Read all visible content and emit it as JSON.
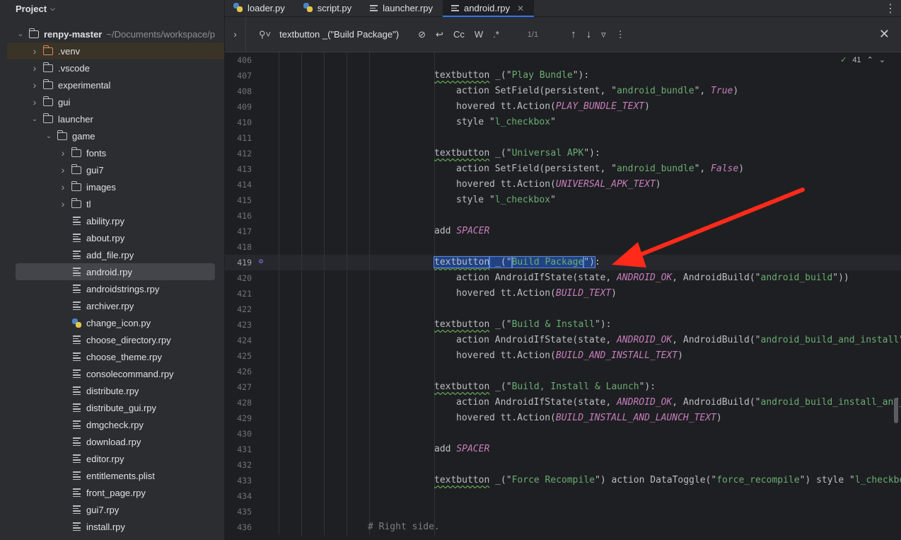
{
  "sidebar": {
    "title": "Project",
    "tree": [
      {
        "label": "renpy-master",
        "path": "~/Documents/workspace/p",
        "type": "root",
        "expanded": true,
        "level": 0
      },
      {
        "label": ".venv",
        "type": "folder-orange",
        "expanded": false,
        "level": 1
      },
      {
        "label": ".vscode",
        "type": "folder",
        "expanded": false,
        "level": 1
      },
      {
        "label": "experimental",
        "type": "folder",
        "expanded": false,
        "level": 1
      },
      {
        "label": "gui",
        "type": "folder",
        "expanded": false,
        "level": 1
      },
      {
        "label": "launcher",
        "type": "folder",
        "expanded": true,
        "level": 1
      },
      {
        "label": "game",
        "type": "folder",
        "expanded": true,
        "level": 2
      },
      {
        "label": "fonts",
        "type": "folder",
        "expanded": false,
        "level": 3
      },
      {
        "label": "gui7",
        "type": "folder",
        "expanded": false,
        "level": 3
      },
      {
        "label": "images",
        "type": "folder",
        "expanded": false,
        "level": 3
      },
      {
        "label": "tl",
        "type": "folder",
        "expanded": false,
        "level": 3
      },
      {
        "label": "ability.rpy",
        "type": "file",
        "level": 3
      },
      {
        "label": "about.rpy",
        "type": "file",
        "level": 3
      },
      {
        "label": "add_file.rpy",
        "type": "file",
        "level": 3
      },
      {
        "label": "android.rpy",
        "type": "file",
        "level": 3,
        "selected": true
      },
      {
        "label": "androidstrings.rpy",
        "type": "file",
        "level": 3
      },
      {
        "label": "archiver.rpy",
        "type": "file",
        "level": 3
      },
      {
        "label": "change_icon.py",
        "type": "python",
        "level": 3
      },
      {
        "label": "choose_directory.rpy",
        "type": "file",
        "level": 3
      },
      {
        "label": "choose_theme.rpy",
        "type": "file",
        "level": 3
      },
      {
        "label": "consolecommand.rpy",
        "type": "file",
        "level": 3
      },
      {
        "label": "distribute.rpy",
        "type": "file",
        "level": 3
      },
      {
        "label": "distribute_gui.rpy",
        "type": "file",
        "level": 3
      },
      {
        "label": "dmgcheck.rpy",
        "type": "file",
        "level": 3
      },
      {
        "label": "download.rpy",
        "type": "file",
        "level": 3
      },
      {
        "label": "editor.rpy",
        "type": "file",
        "level": 3
      },
      {
        "label": "entitlements.plist",
        "type": "file",
        "level": 3
      },
      {
        "label": "front_page.rpy",
        "type": "file",
        "level": 3
      },
      {
        "label": "gui7.rpy",
        "type": "file",
        "level": 3
      },
      {
        "label": "install.rpy",
        "type": "file",
        "level": 3
      }
    ]
  },
  "tabs": [
    {
      "label": "loader.py",
      "icon": "python-icon",
      "active": false
    },
    {
      "label": "script.py",
      "icon": "python-icon",
      "active": false
    },
    {
      "label": "launcher.rpy",
      "icon": "file-icon",
      "active": false
    },
    {
      "label": "android.rpy",
      "icon": "file-icon",
      "active": true,
      "closable": true
    }
  ],
  "find": {
    "query": "textbutton _(\"Build Package\")",
    "match_case": "Cc",
    "words": "W",
    "regex": ".*",
    "count": "1/1"
  },
  "editor": {
    "inspection_count": "41",
    "current_line": 419,
    "lines": [
      {
        "n": "406",
        "indent": 0,
        "parts": []
      },
      {
        "n": "407",
        "indent": 1,
        "parts": [
          [
            "ul",
            "textbutton"
          ],
          [
            "t",
            " _(\""
          ],
          [
            "str",
            "Play Bundle"
          ],
          [
            "t",
            "\"):"
          ]
        ]
      },
      {
        "n": "408",
        "indent": 2,
        "parts": [
          [
            "t",
            "action SetField(persistent, \""
          ],
          [
            "str",
            "android_bundle"
          ],
          [
            "t",
            "\", "
          ],
          [
            "const",
            "True"
          ],
          [
            "t",
            ")"
          ]
        ]
      },
      {
        "n": "409",
        "indent": 2,
        "parts": [
          [
            "t",
            "hovered tt.Action("
          ],
          [
            "const",
            "PLAY_BUNDLE_TEXT"
          ],
          [
            "t",
            ")"
          ]
        ]
      },
      {
        "n": "410",
        "indent": 2,
        "parts": [
          [
            "t",
            "style \""
          ],
          [
            "str",
            "l_checkbox"
          ],
          [
            "t",
            "\""
          ]
        ]
      },
      {
        "n": "411",
        "indent": 0,
        "parts": []
      },
      {
        "n": "412",
        "indent": 1,
        "parts": [
          [
            "ul",
            "textbutton"
          ],
          [
            "t",
            " _(\""
          ],
          [
            "str",
            "Universal APK"
          ],
          [
            "t",
            "\"):"
          ]
        ]
      },
      {
        "n": "413",
        "indent": 2,
        "parts": [
          [
            "t",
            "action SetField(persistent, \""
          ],
          [
            "str",
            "android_bundle"
          ],
          [
            "t",
            "\", "
          ],
          [
            "const",
            "False"
          ],
          [
            "t",
            ")"
          ]
        ]
      },
      {
        "n": "414",
        "indent": 2,
        "parts": [
          [
            "t",
            "hovered tt.Action("
          ],
          [
            "const",
            "UNIVERSAL_APK_TEXT"
          ],
          [
            "t",
            ")"
          ]
        ]
      },
      {
        "n": "415",
        "indent": 2,
        "parts": [
          [
            "t",
            "style \""
          ],
          [
            "str",
            "l_checkbox"
          ],
          [
            "t",
            "\""
          ]
        ]
      },
      {
        "n": "416",
        "indent": 0,
        "parts": []
      },
      {
        "n": "417",
        "indent": 1,
        "parts": [
          [
            "t",
            "add "
          ],
          [
            "const",
            "SPACER"
          ]
        ]
      },
      {
        "n": "418",
        "indent": 0,
        "parts": []
      },
      {
        "n": "419",
        "indent": 1,
        "parts": [
          [
            "sel-ul",
            "textbutton"
          ],
          [
            "sel",
            " _(\""
          ],
          [
            "sel-str",
            "Build Package"
          ],
          [
            "sel",
            "\")"
          ],
          [
            "t",
            ":"
          ]
        ]
      },
      {
        "n": "420",
        "indent": 2,
        "parts": [
          [
            "t",
            "action AndroidIfState(state, "
          ],
          [
            "const",
            "ANDROID_OK"
          ],
          [
            "t",
            ", AndroidBuild(\""
          ],
          [
            "str",
            "android_build"
          ],
          [
            "t",
            "\"))"
          ]
        ]
      },
      {
        "n": "421",
        "indent": 2,
        "parts": [
          [
            "t",
            "hovered tt.Action("
          ],
          [
            "const",
            "BUILD_TEXT"
          ],
          [
            "t",
            ")"
          ]
        ]
      },
      {
        "n": "422",
        "indent": 0,
        "parts": []
      },
      {
        "n": "423",
        "indent": 1,
        "parts": [
          [
            "ul",
            "textbutton"
          ],
          [
            "t",
            " _(\""
          ],
          [
            "str",
            "Build & Install"
          ],
          [
            "t",
            "\"):"
          ]
        ]
      },
      {
        "n": "424",
        "indent": 2,
        "parts": [
          [
            "t",
            "action AndroidIfState(state, "
          ],
          [
            "const",
            "ANDROID_OK"
          ],
          [
            "t",
            ", AndroidBuild(\""
          ],
          [
            "str",
            "android_build_and_install"
          ],
          [
            "t",
            "\""
          ]
        ]
      },
      {
        "n": "425",
        "indent": 2,
        "parts": [
          [
            "t",
            "hovered tt.Action("
          ],
          [
            "const",
            "BUILD_AND_INSTALL_TEXT"
          ],
          [
            "t",
            ")"
          ]
        ]
      },
      {
        "n": "426",
        "indent": 0,
        "parts": []
      },
      {
        "n": "427",
        "indent": 1,
        "parts": [
          [
            "ul",
            "textbutton"
          ],
          [
            "t",
            " _(\""
          ],
          [
            "str",
            "Build, Install & Launch"
          ],
          [
            "t",
            "\"):"
          ]
        ]
      },
      {
        "n": "428",
        "indent": 2,
        "parts": [
          [
            "t",
            "action AndroidIfState(state, "
          ],
          [
            "const",
            "ANDROID_OK"
          ],
          [
            "t",
            ", AndroidBuild(\""
          ],
          [
            "str",
            "android_build_install_and_"
          ]
        ]
      },
      {
        "n": "429",
        "indent": 2,
        "parts": [
          [
            "t",
            "hovered tt.Action("
          ],
          [
            "const",
            "BUILD_INSTALL_AND_LAUNCH_TEXT"
          ],
          [
            "t",
            ")"
          ]
        ]
      },
      {
        "n": "430",
        "indent": 0,
        "parts": []
      },
      {
        "n": "431",
        "indent": 1,
        "parts": [
          [
            "t",
            "add "
          ],
          [
            "const",
            "SPACER"
          ]
        ]
      },
      {
        "n": "432",
        "indent": 0,
        "parts": []
      },
      {
        "n": "433",
        "indent": 1,
        "parts": [
          [
            "ul",
            "textbutton"
          ],
          [
            "t",
            " _(\""
          ],
          [
            "str",
            "Force Recompile"
          ],
          [
            "t",
            "\") action DataToggle(\""
          ],
          [
            "str",
            "force_recompile"
          ],
          [
            "t",
            "\") style \""
          ],
          [
            "str",
            "l_checkbo"
          ]
        ]
      },
      {
        "n": "434",
        "indent": 0,
        "parts": []
      },
      {
        "n": "435",
        "indent": 0,
        "parts": []
      },
      {
        "n": "436",
        "indent": -1,
        "parts": [
          [
            "comment",
            "# Right side."
          ]
        ]
      }
    ]
  },
  "colors": {
    "accent": "#3574f0",
    "string": "#6aab73",
    "constant": "#c77dbb",
    "annotation_arrow": "#ff2a1a"
  }
}
